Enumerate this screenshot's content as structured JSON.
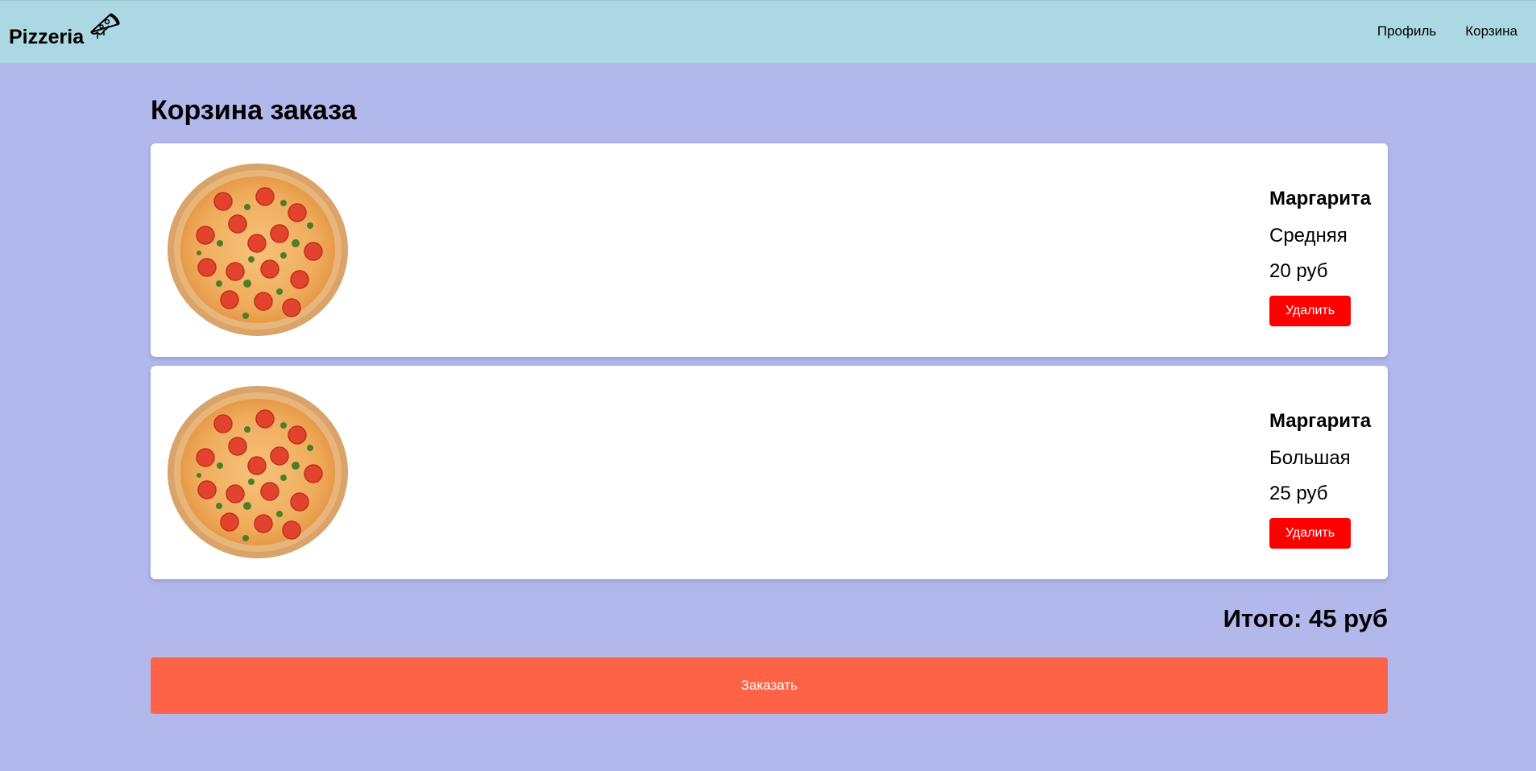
{
  "header": {
    "brand": "Pizzeria",
    "nav": [
      {
        "label": "Профиль"
      },
      {
        "label": "Корзина"
      }
    ]
  },
  "page": {
    "title": "Корзина заказа"
  },
  "cart": {
    "items": [
      {
        "name": "Маргарита",
        "size": "Средняя",
        "price": "20 руб",
        "delete_label": "Удалить"
      },
      {
        "name": "Маргарита",
        "size": "Большая",
        "price": "25 руб",
        "delete_label": "Удалить"
      }
    ],
    "total": "Итого: 45 руб",
    "order_label": "Заказать"
  },
  "colors": {
    "page_bg": "#b2b8eb",
    "header_bg": "#acd8e4",
    "delete_button": "#ff0000",
    "order_button": "#ff6347"
  }
}
